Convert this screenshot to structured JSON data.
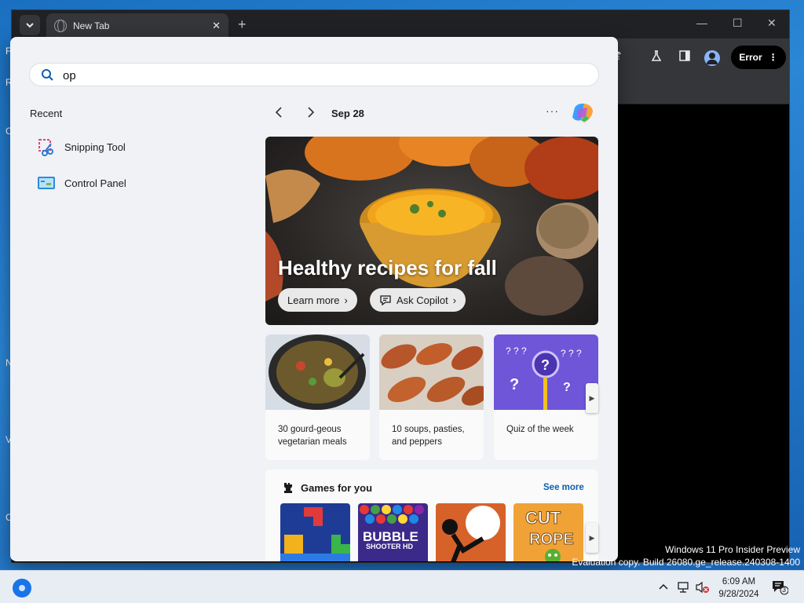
{
  "desktop": {
    "edge_labels": [
      "F",
      "R",
      "C",
      "N",
      "V",
      "C"
    ],
    "watermark_line1": "Windows 11 Pro Insider Preview",
    "watermark_line2": "Evaluation copy. Build 26080.ge_release.240308-1400"
  },
  "browser": {
    "tab_title": "New Tab",
    "tab_close": "✕",
    "new_tab": "+",
    "error_label": "Error"
  },
  "search": {
    "value": "op",
    "placeholder": ""
  },
  "recent": {
    "label": "Recent",
    "items": [
      {
        "name": "Snipping Tool",
        "icon": "snipping-tool-icon"
      },
      {
        "name": "Control Panel",
        "icon": "control-panel-icon"
      }
    ]
  },
  "feed": {
    "date": "Sep 28",
    "more": "···",
    "hero": {
      "title": "Healthy recipes for fall",
      "learn_more": "Learn more",
      "ask_copilot": "Ask Copilot"
    },
    "cards": [
      {
        "text": "30 gourd-geous vegetarian meals"
      },
      {
        "text": "10 soups, pasties, and peppers"
      },
      {
        "text": "Quiz of the week"
      }
    ],
    "games": {
      "title": "Games for you",
      "see_more": "See more",
      "tiles": [
        {
          "name": "Block Puzzle",
          "label": ""
        },
        {
          "name": "Bubble Shooter",
          "label": "BUBBLE SHOOTER HD"
        },
        {
          "name": "Stickman Fighter",
          "label": ""
        },
        {
          "name": "Cut the Rope",
          "label": "CUT the ROPE"
        }
      ]
    }
  },
  "taskbar": {
    "time": "6:09 AM",
    "date": "9/28/2024",
    "notification_count": "3"
  },
  "colors": {
    "accent": "#0f5fb0",
    "flyout_bg": "#f0f2f5",
    "desktop_blue": "#1a6fc0"
  }
}
